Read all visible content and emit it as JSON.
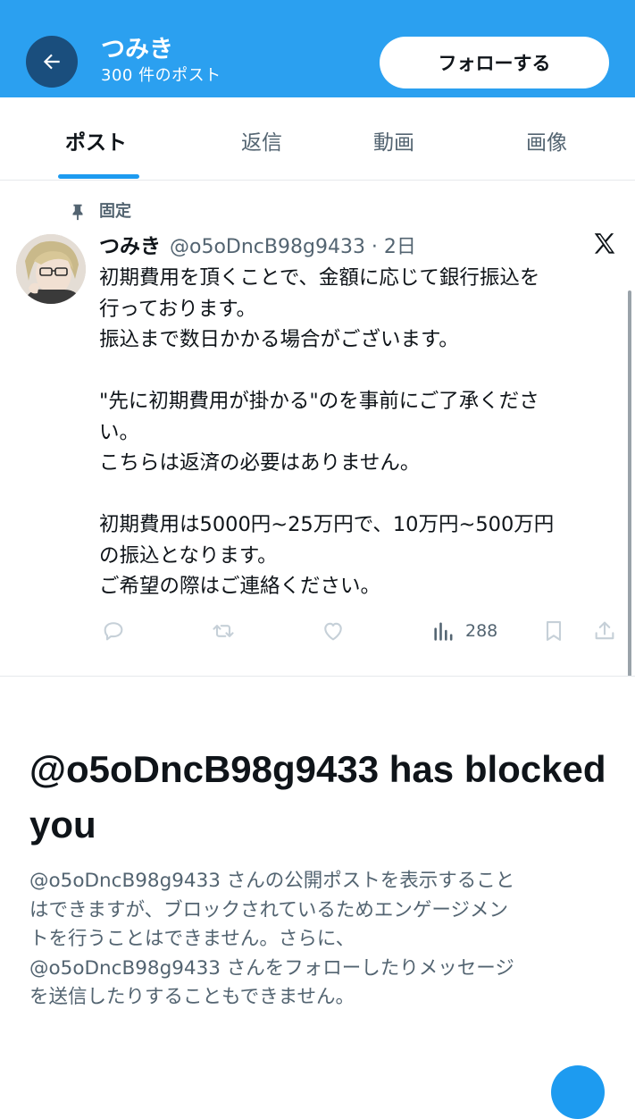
{
  "header": {
    "title": "つみき",
    "subtitle": "300 件のポスト",
    "follow_label": "フォローする"
  },
  "tabs": [
    {
      "label": "ポスト",
      "active": true
    },
    {
      "label": "返信",
      "active": false
    },
    {
      "label": "動画",
      "active": false
    },
    {
      "label": "画像",
      "active": false
    }
  ],
  "post": {
    "pinned_label": "固定",
    "name": "つみき",
    "handle_time": "@o5oDncB98g9433 · 2日",
    "body": "初期費用を頂くことで、金額に応じて銀行振込を\n行っております。\n振込まで数日かかる場合がございます。\n\n\"先に初期費用が掛かる\"のを事前にご了承くださ\nい。\nこちらは返済の必要はありません。\n\n初期費用は5000円~25万円で、10万円~500万円\nの振込となります。\nご希望の際はご連絡ください。",
    "views": "288"
  },
  "blocked": {
    "title": "@o5oDncB98g9433 has blocked you",
    "description": "@o5oDncB98g9433 さんの公開ポストを表示すること\nはできますが、ブロックされているためエンゲージメン\nトを行うことはできません。さらに、\n@o5oDncB98g9433 さんをフォローしたりメッセージ\nを送信したりすることもできません。"
  },
  "colors": {
    "header_bg": "#2ba0f0",
    "back_button_bg": "#1a4e7d",
    "accent": "#1d9bf0",
    "secondary_text": "#536471"
  },
  "icons": [
    "arrow-left-icon",
    "pin-icon",
    "x-logo-icon",
    "reply-icon",
    "repost-icon",
    "like-icon",
    "views-icon",
    "bookmark-icon",
    "share-icon"
  ]
}
